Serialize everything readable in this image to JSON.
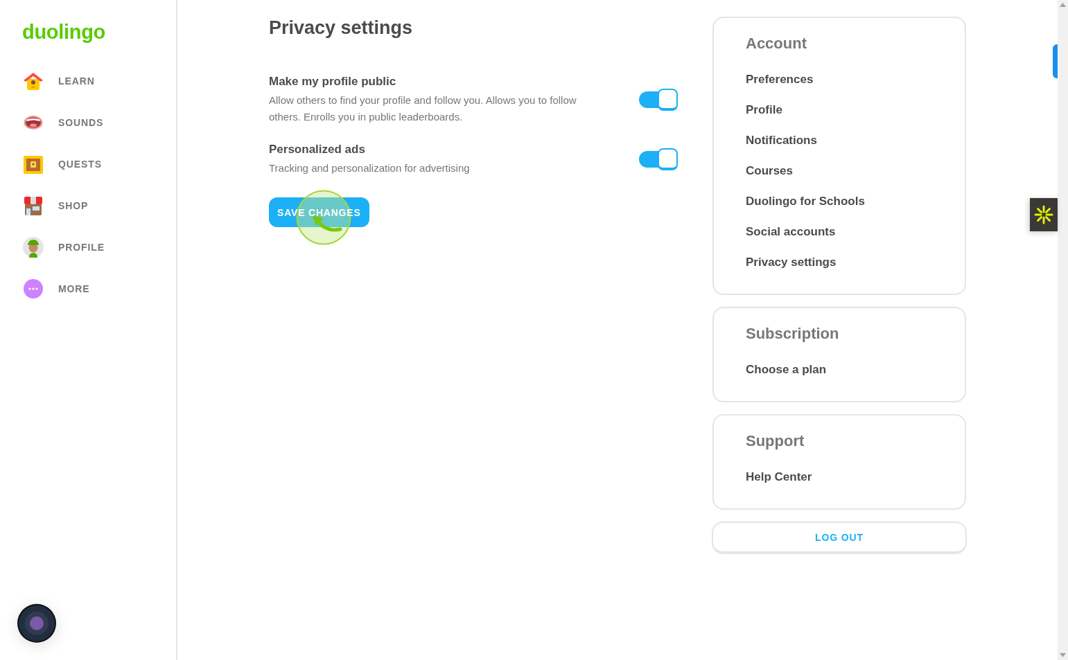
{
  "sidebar": {
    "logo": "duolingo",
    "items": [
      {
        "label": "LEARN",
        "kind": "learn",
        "selected": false
      },
      {
        "label": "SOUNDS",
        "kind": "sounds",
        "selected": false
      },
      {
        "label": "QUESTS",
        "kind": "quests",
        "selected": false
      },
      {
        "label": "SHOP",
        "kind": "shop",
        "selected": false
      },
      {
        "label": "PROFILE",
        "kind": "profile",
        "selected": false
      },
      {
        "label": "MORE",
        "kind": "more",
        "selected": false
      }
    ]
  },
  "main": {
    "title": "Privacy settings",
    "settings": [
      {
        "title": "Make my profile public",
        "description": "Allow others to find your profile and follow you. Allows you to follow others. Enrolls you in public leaderboards.",
        "on": true
      },
      {
        "title": "Personalized ads",
        "description": "Tracking and personalization for advertising",
        "on": true
      }
    ],
    "save_button": "SAVE CHANGES"
  },
  "panels": [
    {
      "heading": "Account",
      "links": [
        "Preferences",
        "Profile",
        "Notifications",
        "Courses",
        "Duolingo for Schools",
        "Social accounts",
        "Privacy settings"
      ]
    },
    {
      "heading": "Subscription",
      "links": [
        "Choose a plan"
      ]
    },
    {
      "heading": "Support",
      "links": [
        "Help Center"
      ]
    }
  ],
  "logout_button": "LOG OUT"
}
